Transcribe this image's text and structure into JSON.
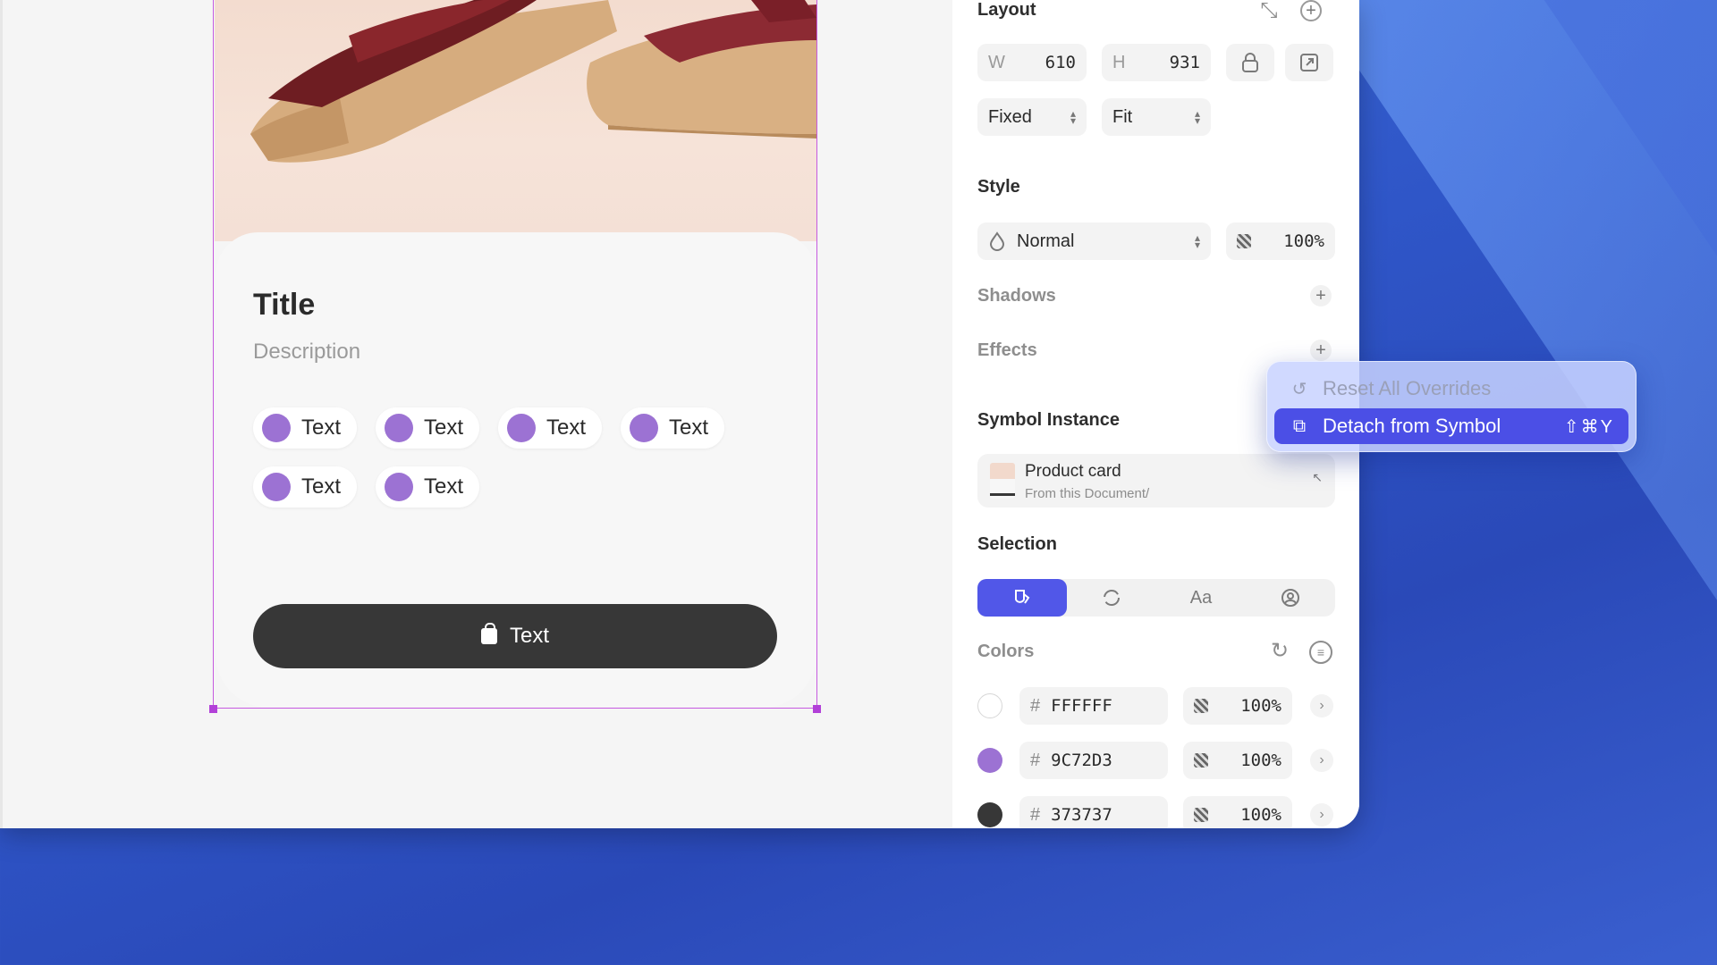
{
  "card": {
    "title": "Title",
    "description": "Description",
    "chips": [
      "Text",
      "Text",
      "Text",
      "Text",
      "Text",
      "Text"
    ],
    "cta_label": "Text"
  },
  "inspector": {
    "layout": {
      "title": "Layout",
      "w_label": "W",
      "w_value": "610",
      "h_label": "H",
      "h_value": "931",
      "width_mode": "Fixed",
      "height_mode": "Fit"
    },
    "style": {
      "title": "Style",
      "blend_mode": "Normal",
      "opacity": "100%"
    },
    "shadows_title": "Shadows",
    "effects_title": "Effects",
    "symbol": {
      "title": "Symbol Instance",
      "name": "Product card",
      "source": "From this Document/"
    },
    "selection": {
      "title": "Selection",
      "text_tab": "Aa"
    },
    "colors": {
      "title": "Colors",
      "items": [
        {
          "hex": "FFFFFF",
          "opacity": "100%",
          "swatch": "#ffffff"
        },
        {
          "hex": "9C72D3",
          "opacity": "100%",
          "swatch": "#9c72d3"
        },
        {
          "hex": "373737",
          "opacity": "100%",
          "swatch": "#373737"
        }
      ],
      "hash": "#"
    }
  },
  "context_menu": {
    "reset_label": "Reset All Overrides",
    "detach_label": "Detach from Symbol",
    "detach_shortcut": "⇧⌘Y"
  },
  "colors": {
    "accent": "#5157e8",
    "menu_highlight": "#4b4fe6",
    "chip_dot": "#9c72d3",
    "button_dark": "#373737",
    "selection_frame": "#c65ae0"
  }
}
